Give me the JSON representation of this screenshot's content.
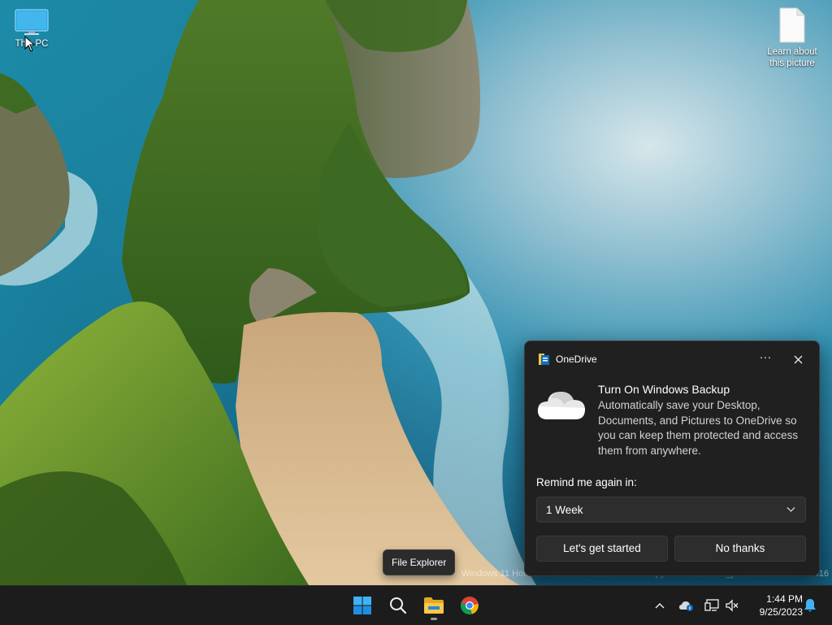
{
  "desktop": {
    "icons": [
      {
        "label": "This PC",
        "icon": "monitor-icon"
      },
      {
        "label": "Learn about this picture",
        "icon": "document-icon"
      }
    ],
    "watermark": "Windows 11 Home Insider Preview Evaluation copy. Build 25947.rs_prerelease.230901-1416"
  },
  "tooltip": {
    "text": "File Explorer"
  },
  "toast": {
    "app_name": "OneDrive",
    "more_label": "···",
    "title": "Turn On Windows Backup",
    "body": "Automatically save your Desktop, Documents, and Pictures to OneDrive so you can keep them protected and access them from anywhere.",
    "remind_label": "Remind me again in:",
    "remind_value": "1 Week",
    "buttons": {
      "primary": "Let's get started",
      "secondary": "No thanks"
    }
  },
  "taskbar": {
    "apps": [
      {
        "name": "Start",
        "icon": "windows-logo-icon"
      },
      {
        "name": "Search",
        "icon": "search-icon"
      },
      {
        "name": "File Explorer",
        "icon": "folder-icon",
        "running": true
      },
      {
        "name": "Google Chrome",
        "icon": "chrome-icon"
      }
    ],
    "tray": [
      "chevron-up-icon",
      "onedrive-icon",
      "network-icon",
      "volume-muted-icon",
      "notification-bell-icon"
    ],
    "time": "1:44 PM",
    "date": "9/25/2023"
  },
  "colors": {
    "accent": "#0078d4",
    "toast_bg": "#202020",
    "taskbar_bg": "#1c1c1c"
  }
}
